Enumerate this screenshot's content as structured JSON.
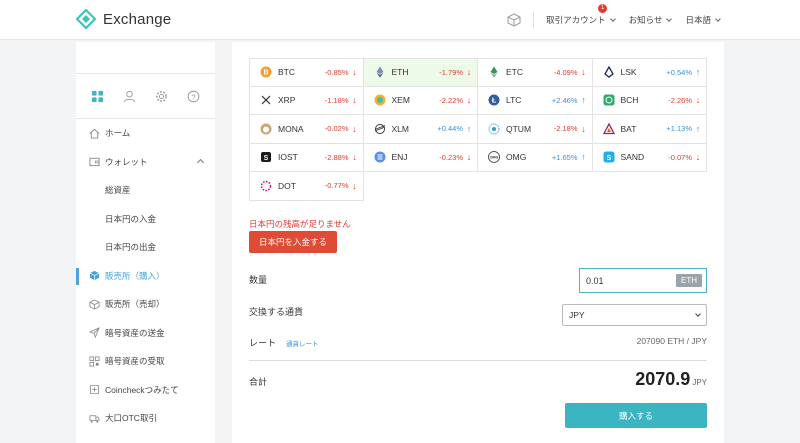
{
  "header": {
    "logo_text": "Exchange",
    "menus": [
      {
        "label": "取引アカウント",
        "badge": "1"
      },
      {
        "label": "お知らせ"
      },
      {
        "label": "日本語"
      }
    ]
  },
  "sidebar": {
    "tabs": [
      "dashboard-icon",
      "user-icon",
      "gear-icon",
      "help-icon"
    ],
    "items": [
      {
        "label": "ホーム",
        "icon": "home-icon"
      },
      {
        "label": "ウォレット",
        "icon": "wallet-icon"
      },
      {
        "label": "総資産"
      },
      {
        "label": "日本円の入金"
      },
      {
        "label": "日本円の出金"
      },
      {
        "label": "販売所（購入）",
        "icon": "box-icon"
      },
      {
        "label": "販売所（売却）",
        "icon": "box-icon"
      },
      {
        "label": "暗号資産の送金",
        "icon": "send-icon"
      },
      {
        "label": "暗号資産の受取",
        "icon": "qr-icon"
      },
      {
        "label": "Coincheckつみたて",
        "icon": "piggy-icon"
      },
      {
        "label": "大口OTC取引",
        "icon": "truck-icon"
      }
    ]
  },
  "coins": [
    {
      "name": "BTC",
      "change": "-0.85%",
      "dir": "down"
    },
    {
      "name": "ETH",
      "change": "-1.79%",
      "dir": "down"
    },
    {
      "name": "ETC",
      "change": "-4.09%",
      "dir": "down"
    },
    {
      "name": "LSK",
      "change": "+0.54%",
      "dir": "up"
    },
    {
      "name": "XRP",
      "change": "-1.18%",
      "dir": "down"
    },
    {
      "name": "XEM",
      "change": "-2.22%",
      "dir": "down"
    },
    {
      "name": "LTC",
      "change": "+2.46%",
      "dir": "up"
    },
    {
      "name": "BCH",
      "change": "-2.26%",
      "dir": "down"
    },
    {
      "name": "MONA",
      "change": "-0.02%",
      "dir": "down"
    },
    {
      "name": "XLM",
      "change": "+0.44%",
      "dir": "up"
    },
    {
      "name": "QTUM",
      "change": "-2.18%",
      "dir": "down"
    },
    {
      "name": "BAT",
      "change": "+1.13%",
      "dir": "up"
    },
    {
      "name": "IOST",
      "change": "-2.88%",
      "dir": "down"
    },
    {
      "name": "ENJ",
      "change": "-0.23%",
      "dir": "down"
    },
    {
      "name": "OMG",
      "change": "+1.65%",
      "dir": "up"
    },
    {
      "name": "SAND",
      "change": "-0.07%",
      "dir": "down"
    },
    {
      "name": "DOT",
      "change": "-0.77%",
      "dir": "down"
    }
  ],
  "selected_coin": "ETH",
  "form": {
    "warning": "日本円の残高が足りません",
    "deposit_button": "日本円を入金する",
    "quantity_label": "数量",
    "quantity_value": "0.01",
    "quantity_unit": "ETH",
    "currency_label": "交換する通貨",
    "currency_value": "JPY",
    "rate_label": "レート",
    "rate_link": "通貨レート",
    "rate_value": "207090  ETH / JPY",
    "total_label": "合計",
    "total_value": "2070.9",
    "total_currency": "JPY",
    "buy_button": "購入する"
  },
  "colors": {
    "accent": "#3ab5c1",
    "danger": "#df4b35",
    "up": "#3d8fd6",
    "down": "#e03b2f",
    "selected_bg": "#eefae9"
  }
}
